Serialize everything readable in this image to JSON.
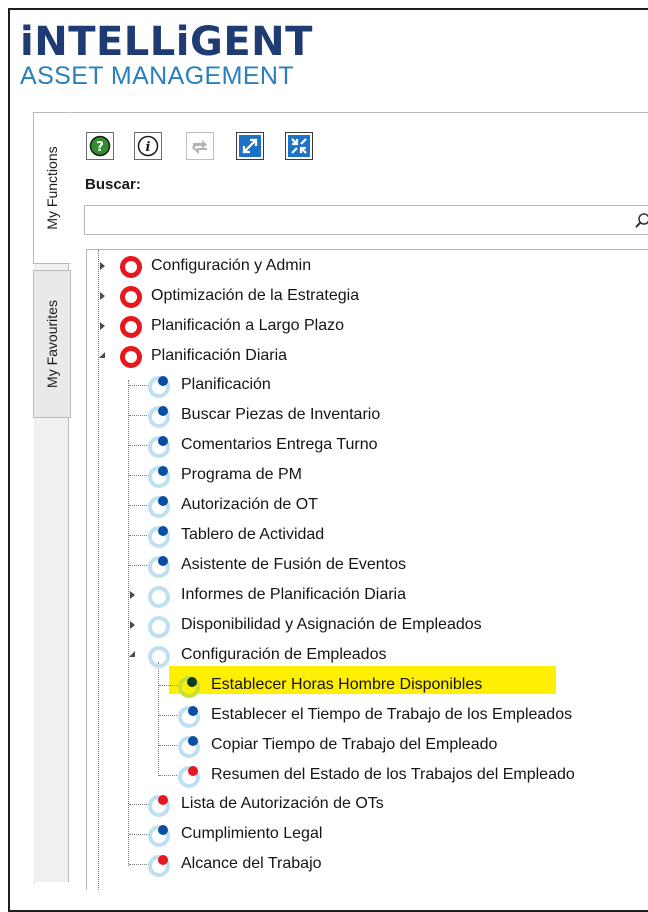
{
  "logo": {
    "top": "iNTELLiGENT",
    "bottom": "ASSET MANAGEMENT"
  },
  "side_tabs": [
    {
      "label": "My Functions",
      "active": true
    },
    {
      "label": "My Favourites",
      "active": false
    }
  ],
  "toolbar": {
    "buttons": [
      "help-icon",
      "info-icon",
      "refresh-icon",
      "expand-icon",
      "collapse-icon"
    ]
  },
  "search": {
    "label": "Buscar:",
    "value": "",
    "placeholder": ""
  },
  "tree": {
    "items": [
      {
        "label": "Configuración y Admin",
        "expander": "closed",
        "icon": "red-ring"
      },
      {
        "label": "Optimización de la Estrategia",
        "expander": "closed",
        "icon": "red-ring"
      },
      {
        "label": "Planificación a Largo Plazo",
        "expander": "closed",
        "icon": "red-ring"
      },
      {
        "label": "Planificación Diaria",
        "expander": "open",
        "icon": "red-ring"
      },
      {
        "label": "Planificación",
        "icon": "blue-dot"
      },
      {
        "label": "Buscar Piezas de Inventario",
        "icon": "blue-dot"
      },
      {
        "label": "Comentarios Entrega Turno",
        "icon": "blue-dot"
      },
      {
        "label": "Programa de PM",
        "icon": "blue-dot"
      },
      {
        "label": "Autorización de OT",
        "icon": "blue-dot"
      },
      {
        "label": "Tablero de Actividad",
        "icon": "blue-dot"
      },
      {
        "label": "Asistente de Fusión de Eventos",
        "icon": "blue-dot"
      },
      {
        "label": "Informes de Planificación Diaria",
        "expander": "closed",
        "icon": "light-ring"
      },
      {
        "label": "Disponibilidad y Asignación de Empleados",
        "expander": "closed",
        "icon": "light-ring"
      },
      {
        "label": "Configuración de Empleados",
        "expander": "open",
        "icon": "light-ring"
      },
      {
        "label": "Establecer Horas Hombre Disponibles",
        "icon": "dark-dot",
        "selected": true
      },
      {
        "label": "Establecer el Tiempo de Trabajo de los Empleados",
        "icon": "blue-dot"
      },
      {
        "label": "Copiar Tiempo de Trabajo del Empleado",
        "icon": "blue-dot"
      },
      {
        "label": "Resumen del Estado de los Trabajos del Empleado",
        "icon": "red-dot"
      },
      {
        "label": "Lista de Autorización de OTs",
        "icon": "red-dot"
      },
      {
        "label": "Cumplimiento Legal",
        "icon": "blue-dot"
      },
      {
        "label": "Alcance del Trabajo",
        "icon": "red-dot"
      }
    ]
  },
  "colors": {
    "brand_dark": "#1f3b73",
    "brand_light": "#2a7fbd",
    "ring_red": "#e8161d",
    "dot_blue": "#0a4ea3",
    "dot_red": "#e8161d",
    "highlight": "#ffef00"
  }
}
